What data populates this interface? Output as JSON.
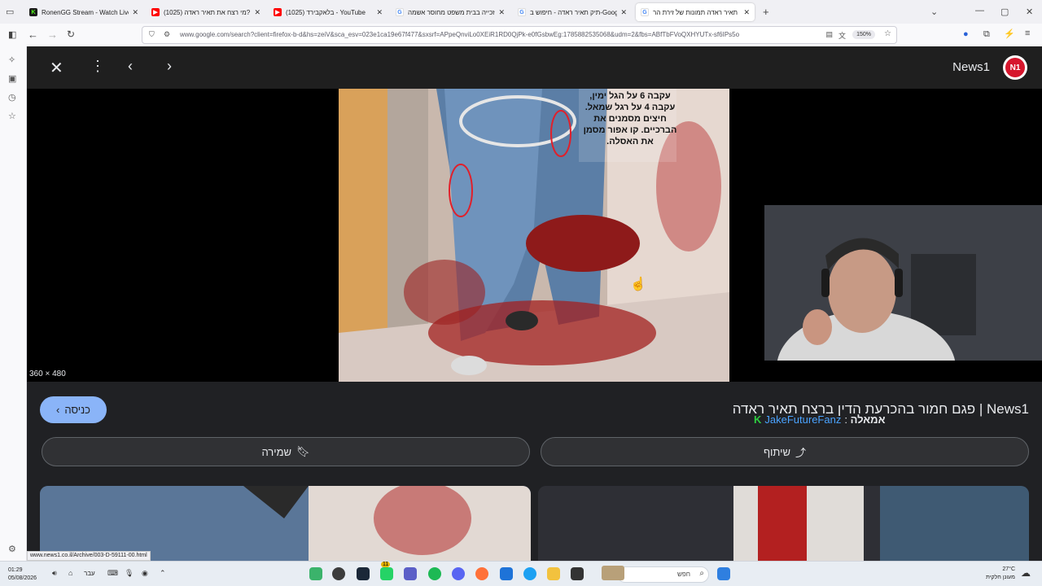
{
  "browser": {
    "tabs": [
      {
        "title": "RonenGG Stream - Watch Live o",
        "favicon": "kick",
        "color": "#53fc18"
      },
      {
        "title": "(1025) מי רצח את תאיר ראדה?",
        "favicon": "youtube",
        "color": "#ff0000"
      },
      {
        "title": "(1025) בלאקבירד - YouTube",
        "favicon": "youtube",
        "color": "#ff0000"
      },
      {
        "title": "זכייה בבית משפט מחוסר אשמה",
        "favicon": "google",
        "color": "#4285f4"
      },
      {
        "title": "תיק תאיר ראדה - חיפוש ב-Google",
        "favicon": "google",
        "color": "#4285f4"
      },
      {
        "title": "תאיר ראדה תמונות של זירת הר",
        "favicon": "google",
        "color": "#4285f4",
        "active": true
      }
    ],
    "url": "www.google.com/search?client=firefox-b-d&hs=zeiV&sca_esv=023e1ca19e67f477&sxsrf=APpeQnviLo0XEiR1RD0QjPk-e0fGsbwEg:1785882535068&udm=2&fbs=ABfTbFVoQXHYUTx-sf6IPs5o",
    "zoom": "150%",
    "status_url": "www.news1.co.il/Archive/003-D-59111-00.html"
  },
  "viewer": {
    "source_name": "News1",
    "source_logo_text": "N1",
    "image_dimensions": "360 × 480",
    "image_overlay_text": "עקבה 6 על הגל ימין, עקבה 4 על רגל שמאל. חיצים מסמנים את הברכיים. קו אפור מסמן את האסלה.",
    "title": "News1 | פגם חמור בהכרעת הדין ברצח תאיר ראדה",
    "visit_label": "כניסה",
    "save_label": "שמירה",
    "share_label": "שיתוף"
  },
  "chat_overlay": {
    "badge": "K",
    "username": "JakeFutureFanz",
    "separator": ":",
    "message": "אמאלה"
  },
  "taskbar": {
    "time": "01:29",
    "date": "05/08/2026",
    "language": "עבר",
    "search_placeholder": "חפש",
    "temperature": "27°C",
    "weather_text": "מעונן חלקית",
    "notification_count": "11"
  }
}
